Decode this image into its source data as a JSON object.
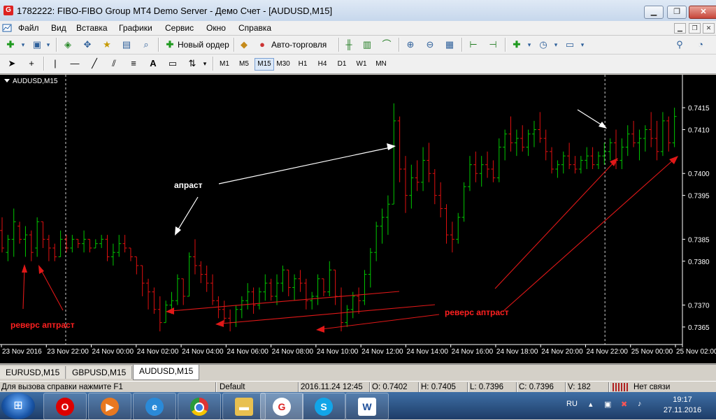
{
  "window": {
    "title": "1782222: FIBO-FIBO Group MT4 Demo Server - Демо Счет - [AUDUSD,M15]",
    "app_icon": "G",
    "buttons": [
      "minimize-icon",
      "restore-icon",
      "close-icon"
    ]
  },
  "menu": [
    "Файл",
    "Вид",
    "Вставка",
    "Графики",
    "Сервис",
    "Окно",
    "Справка"
  ],
  "toolbar": {
    "new_order": "Новый ордер",
    "auto_trading": "Авто-торговля"
  },
  "timeframes": [
    "M1",
    "M5",
    "M15",
    "M30",
    "H1",
    "H4",
    "D1",
    "W1",
    "MN"
  ],
  "active_timeframe": "M15",
  "chart": {
    "symbol_label": "AUDUSD,M15",
    "annotations": {
      "upthrust_1": "апраст",
      "reverse_left": "реверс аптраст",
      "reverse_right": "реверс аптраст"
    }
  },
  "chart_data": {
    "type": "bar",
    "title": "AUDUSD,M15",
    "price_labels": [
      "0.7415",
      "0.7410",
      "0.7400",
      "0.7395",
      "0.7385",
      "0.7380",
      "0.7370",
      "0.7365"
    ],
    "ylim": [
      0.7361,
      0.7419
    ],
    "time_labels": [
      "23 Nov 2016",
      "23 Nov 22:00",
      "24 Nov 00:00",
      "24 Nov 02:00",
      "24 Nov 04:00",
      "24 Nov 06:00",
      "24 Nov 08:00",
      "24 Nov 10:00",
      "24 Nov 12:00",
      "24 Nov 14:00",
      "24 Nov 16:00",
      "24 Nov 18:00",
      "24 Nov 20:00",
      "24 Nov 22:00",
      "25 Nov 00:00",
      "25 Nov 02:00"
    ],
    "colors": {
      "up": "#00c800",
      "down": "#e01010",
      "background": "#000000",
      "annotation": "#ff2020",
      "arrow_white": "#ffffff"
    },
    "bars": [
      [
        0.739,
        0.7382,
        0.7387,
        0.7383
      ],
      [
        0.7386,
        0.738,
        0.7382,
        0.7385
      ],
      [
        0.7392,
        0.7381,
        0.7385,
        0.7389
      ],
      [
        0.7389,
        0.7384,
        0.7388,
        0.7385
      ],
      [
        0.7388,
        0.7381,
        0.7385,
        0.7386
      ],
      [
        0.7387,
        0.738,
        0.7386,
        0.7382
      ],
      [
        0.739,
        0.7381,
        0.7383,
        0.7389
      ],
      [
        0.7389,
        0.7383,
        0.7389,
        0.7385
      ],
      [
        0.7386,
        0.738,
        0.7385,
        0.7383
      ],
      [
        0.7384,
        0.738,
        0.7383,
        0.7381
      ],
      [
        0.7387,
        0.7381,
        0.7381,
        0.7385
      ],
      [
        0.7386,
        0.7382,
        0.7385,
        0.7383
      ],
      [
        0.7386,
        0.7382,
        0.7383,
        0.7385
      ],
      [
        0.7385,
        0.7383,
        0.7385,
        0.7384
      ],
      [
        0.7387,
        0.7382,
        0.7384,
        0.7385
      ],
      [
        0.7385,
        0.7382,
        0.7385,
        0.7383
      ],
      [
        0.7385,
        0.7383,
        0.7383,
        0.7384
      ],
      [
        0.7386,
        0.7383,
        0.7384,
        0.7385
      ],
      [
        0.7386,
        0.738,
        0.7385,
        0.7381
      ],
      [
        0.7384,
        0.7379,
        0.7381,
        0.7382
      ],
      [
        0.7386,
        0.7381,
        0.7382,
        0.7384
      ],
      [
        0.7386,
        0.7382,
        0.7384,
        0.7383
      ],
      [
        0.7383,
        0.738,
        0.7383,
        0.7381
      ],
      [
        0.7381,
        0.7377,
        0.7381,
        0.7379
      ],
      [
        0.7379,
        0.7372,
        0.7379,
        0.7375
      ],
      [
        0.7376,
        0.7369,
        0.7375,
        0.7373
      ],
      [
        0.7374,
        0.7368,
        0.7373,
        0.7369
      ],
      [
        0.7372,
        0.7364,
        0.7369,
        0.7366
      ],
      [
        0.7371,
        0.7366,
        0.7366,
        0.737
      ],
      [
        0.7373,
        0.7368,
        0.737,
        0.7371
      ],
      [
        0.7377,
        0.737,
        0.7371,
        0.7376
      ],
      [
        0.7376,
        0.737,
        0.7376,
        0.7372
      ],
      [
        0.7382,
        0.7372,
        0.7372,
        0.7381
      ],
      [
        0.7385,
        0.7377,
        0.7381,
        0.7379
      ],
      [
        0.738,
        0.7375,
        0.7379,
        0.7377
      ],
      [
        0.7379,
        0.7373,
        0.7377,
        0.7375
      ],
      [
        0.7377,
        0.737,
        0.7375,
        0.7371
      ],
      [
        0.7372,
        0.7367,
        0.7371,
        0.7369
      ],
      [
        0.7371,
        0.7366,
        0.7369,
        0.7367
      ],
      [
        0.7369,
        0.7364,
        0.7367,
        0.7366
      ],
      [
        0.737,
        0.7365,
        0.7366,
        0.7369
      ],
      [
        0.7372,
        0.7367,
        0.7369,
        0.7371
      ],
      [
        0.7375,
        0.7369,
        0.7371,
        0.7373
      ],
      [
        0.7374,
        0.7368,
        0.7373,
        0.737
      ],
      [
        0.7374,
        0.7369,
        0.737,
        0.7373
      ],
      [
        0.7377,
        0.7371,
        0.7373,
        0.7375
      ],
      [
        0.7376,
        0.7371,
        0.7375,
        0.7372
      ],
      [
        0.7377,
        0.737,
        0.7372,
        0.7375
      ],
      [
        0.7379,
        0.7373,
        0.7375,
        0.7378
      ],
      [
        0.7378,
        0.7372,
        0.7378,
        0.7374
      ],
      [
        0.7377,
        0.7371,
        0.7374,
        0.7376
      ],
      [
        0.7378,
        0.7373,
        0.7376,
        0.7375
      ],
      [
        0.7376,
        0.7369,
        0.7375,
        0.7371
      ],
      [
        0.7373,
        0.7369,
        0.7371,
        0.7372
      ],
      [
        0.7377,
        0.737,
        0.7372,
        0.7376
      ],
      [
        0.7376,
        0.7372,
        0.7376,
        0.7373
      ],
      [
        0.738,
        0.7372,
        0.7373,
        0.7378
      ],
      [
        0.7378,
        0.737,
        0.7378,
        0.7372
      ],
      [
        0.7374,
        0.7364,
        0.7372,
        0.7366
      ],
      [
        0.737,
        0.7365,
        0.7366,
        0.7369
      ],
      [
        0.7373,
        0.7367,
        0.7369,
        0.7372
      ],
      [
        0.7374,
        0.7368,
        0.7372,
        0.7371
      ],
      [
        0.7378,
        0.737,
        0.7371,
        0.7377
      ],
      [
        0.7383,
        0.7374,
        0.7377,
        0.7382
      ],
      [
        0.7389,
        0.738,
        0.7382,
        0.7388
      ],
      [
        0.7392,
        0.7384,
        0.7388,
        0.739
      ],
      [
        0.7395,
        0.7386,
        0.739,
        0.7393
      ],
      [
        0.7416,
        0.7393,
        0.7393,
        0.7412
      ],
      [
        0.7413,
        0.7398,
        0.7412,
        0.7401
      ],
      [
        0.7404,
        0.7391,
        0.7401,
        0.7395
      ],
      [
        0.7402,
        0.7392,
        0.7395,
        0.7399
      ],
      [
        0.7403,
        0.7396,
        0.7399,
        0.7398
      ],
      [
        0.7406,
        0.7396,
        0.7398,
        0.7403
      ],
      [
        0.7407,
        0.7398,
        0.7403,
        0.74
      ],
      [
        0.7401,
        0.7393,
        0.74,
        0.7395
      ],
      [
        0.7398,
        0.739,
        0.7395,
        0.7392
      ],
      [
        0.7393,
        0.7384,
        0.7392,
        0.7386
      ],
      [
        0.7389,
        0.7382,
        0.7386,
        0.7385
      ],
      [
        0.7391,
        0.7384,
        0.7385,
        0.739
      ],
      [
        0.7398,
        0.7389,
        0.739,
        0.7397
      ],
      [
        0.7404,
        0.7396,
        0.7397,
        0.7402
      ],
      [
        0.7405,
        0.7398,
        0.7402,
        0.74
      ],
      [
        0.7404,
        0.7397,
        0.74,
        0.7402
      ],
      [
        0.7405,
        0.7399,
        0.7402,
        0.7401
      ],
      [
        0.7403,
        0.7398,
        0.7401,
        0.7399
      ],
      [
        0.7408,
        0.7398,
        0.7399,
        0.7406
      ],
      [
        0.741,
        0.7403,
        0.7406,
        0.7409
      ],
      [
        0.7413,
        0.7405,
        0.7409,
        0.7407
      ],
      [
        0.741,
        0.7404,
        0.7407,
        0.7408
      ],
      [
        0.7411,
        0.7405,
        0.7408,
        0.7406
      ],
      [
        0.741,
        0.7404,
        0.7406,
        0.7409
      ],
      [
        0.7412,
        0.7406,
        0.7409,
        0.741
      ],
      [
        0.7414,
        0.7407,
        0.741,
        0.7408
      ],
      [
        0.741,
        0.7403,
        0.7408,
        0.7405
      ],
      [
        0.7406,
        0.74,
        0.7405,
        0.7401
      ],
      [
        0.7403,
        0.7399,
        0.7401,
        0.7402
      ],
      [
        0.7405,
        0.74,
        0.7402,
        0.7404
      ],
      [
        0.7407,
        0.7401,
        0.7404,
        0.7402
      ],
      [
        0.7404,
        0.74,
        0.7402,
        0.7401
      ],
      [
        0.7404,
        0.74,
        0.7401,
        0.7403
      ],
      [
        0.7406,
        0.7401,
        0.7403,
        0.7404
      ],
      [
        0.7406,
        0.7401,
        0.7404,
        0.7402
      ],
      [
        0.7405,
        0.7401,
        0.7402,
        0.7404
      ],
      [
        0.7407,
        0.7402,
        0.7404,
        0.7405
      ],
      [
        0.7408,
        0.7403,
        0.7405,
        0.7407
      ],
      [
        0.741,
        0.7401,
        0.7407,
        0.7403
      ],
      [
        0.7408,
        0.7401,
        0.7403,
        0.7406
      ],
      [
        0.7411,
        0.7404,
        0.7406,
        0.7409
      ],
      [
        0.7412,
        0.7406,
        0.7409,
        0.7407
      ],
      [
        0.741,
        0.7403,
        0.7407,
        0.7408
      ],
      [
        0.7411,
        0.7405,
        0.7408,
        0.741
      ],
      [
        0.7414,
        0.7406,
        0.741,
        0.7408
      ],
      [
        0.7412,
        0.7403,
        0.7408,
        0.7405
      ],
      [
        0.7414,
        0.7404,
        0.7405,
        0.7412
      ],
      [
        0.7413,
        0.7405,
        0.7412,
        0.7407
      ],
      [
        0.7415,
        0.7406,
        0.7407,
        0.7413
      ]
    ]
  },
  "tabs": [
    "EURUSD,M15",
    "GBPUSD,M15",
    "AUDUSD,M15"
  ],
  "active_tab": "AUDUSD,M15",
  "status": {
    "help": "Для вызова справки нажмите F1",
    "profile": "Default",
    "datetime": "2016.11.24 12:45",
    "open": "O: 0.7402",
    "high": "H: 0.7405",
    "low": "L: 0.7396",
    "close": "C: 0.7396",
    "volume": "V: 182",
    "connection": "Нет связи"
  },
  "taskbar": {
    "language": "RU",
    "time": "19:17",
    "date": "27.11.2016",
    "apps": [
      "opera-icon",
      "media-player-icon",
      "internet-explorer-icon",
      "chrome-icon",
      "explorer-icon",
      "fibo-icon",
      "skype-icon",
      "word-icon"
    ]
  }
}
